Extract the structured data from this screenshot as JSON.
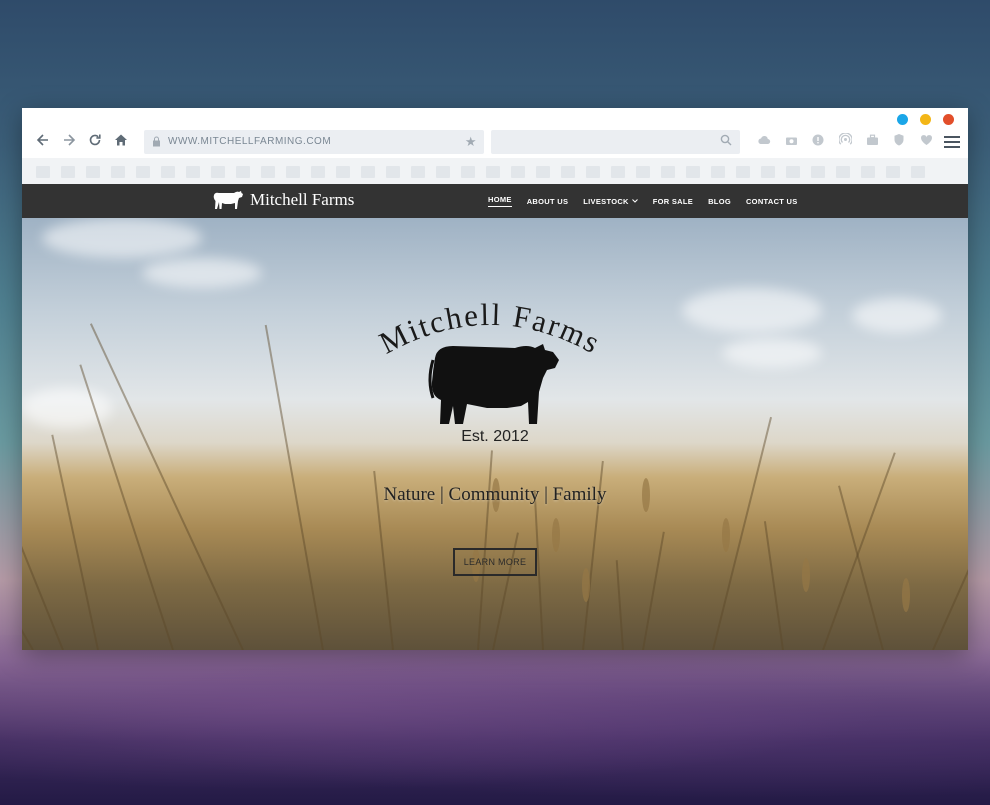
{
  "browser": {
    "url": "WWW.MITCHELLFARMING.COM",
    "search_placeholder": "",
    "traffic_colors": [
      "#1aa6e8",
      "#f3b617",
      "#e24e2a"
    ],
    "nav_icons": [
      "back-arrow-icon",
      "forward-arrow-icon",
      "reload-icon",
      "home-icon"
    ],
    "toolbar_icons": [
      "cloud-download-icon",
      "camera-icon",
      "info-icon",
      "broadcast-icon",
      "briefcase-icon",
      "shield-icon",
      "heart-icon",
      "hamburger-menu-icon"
    ]
  },
  "site": {
    "brand": "Mitchell Farms",
    "nav": [
      {
        "label": "HOME",
        "active": true
      },
      {
        "label": "ABOUT US",
        "active": false
      },
      {
        "label": "LIVESTOCK",
        "active": false,
        "dropdown": true
      },
      {
        "label": "FOR SALE",
        "active": false
      },
      {
        "label": "BLOG",
        "active": false
      },
      {
        "label": "CONTACT US",
        "active": false
      }
    ],
    "hero": {
      "arc_title": "Mitchell Farms",
      "established": "Est. 2012",
      "tagline": "Nature | Community | Family",
      "cta": "LEARN MORE"
    },
    "colors": {
      "nav_bg": "#333333",
      "accent": "#222222"
    }
  }
}
